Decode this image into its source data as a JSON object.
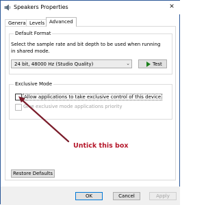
{
  "window": {
    "title": "Speakers Properties"
  },
  "tabs": [
    {
      "label": "General",
      "active": false
    },
    {
      "label": "Levels",
      "active": false
    },
    {
      "label": "Advanced",
      "active": true
    }
  ],
  "default_format": {
    "heading": "Default Format",
    "description": "Select the sample rate and bit depth to be used when running in shared mode.",
    "selected": "24 bit, 48000 Hz (Studio Quality)",
    "test_label": "Test"
  },
  "exclusive_mode": {
    "heading": "Exclusive Mode",
    "allow_label": "Allow applications to take exclusive control of this device",
    "allow_checked": false,
    "priority_label": "Give exclusive mode applications priority",
    "priority_checked": false
  },
  "annotation": {
    "text": "Untick this box",
    "color": "#b5172a"
  },
  "restore_label": "Restore Defaults",
  "buttons": {
    "ok": "OK",
    "cancel": "Cancel",
    "apply": "Apply"
  },
  "colors": {
    "accent": "#0078d7",
    "annotation": "#b5172a",
    "test_icon": "#1a7f1a"
  }
}
